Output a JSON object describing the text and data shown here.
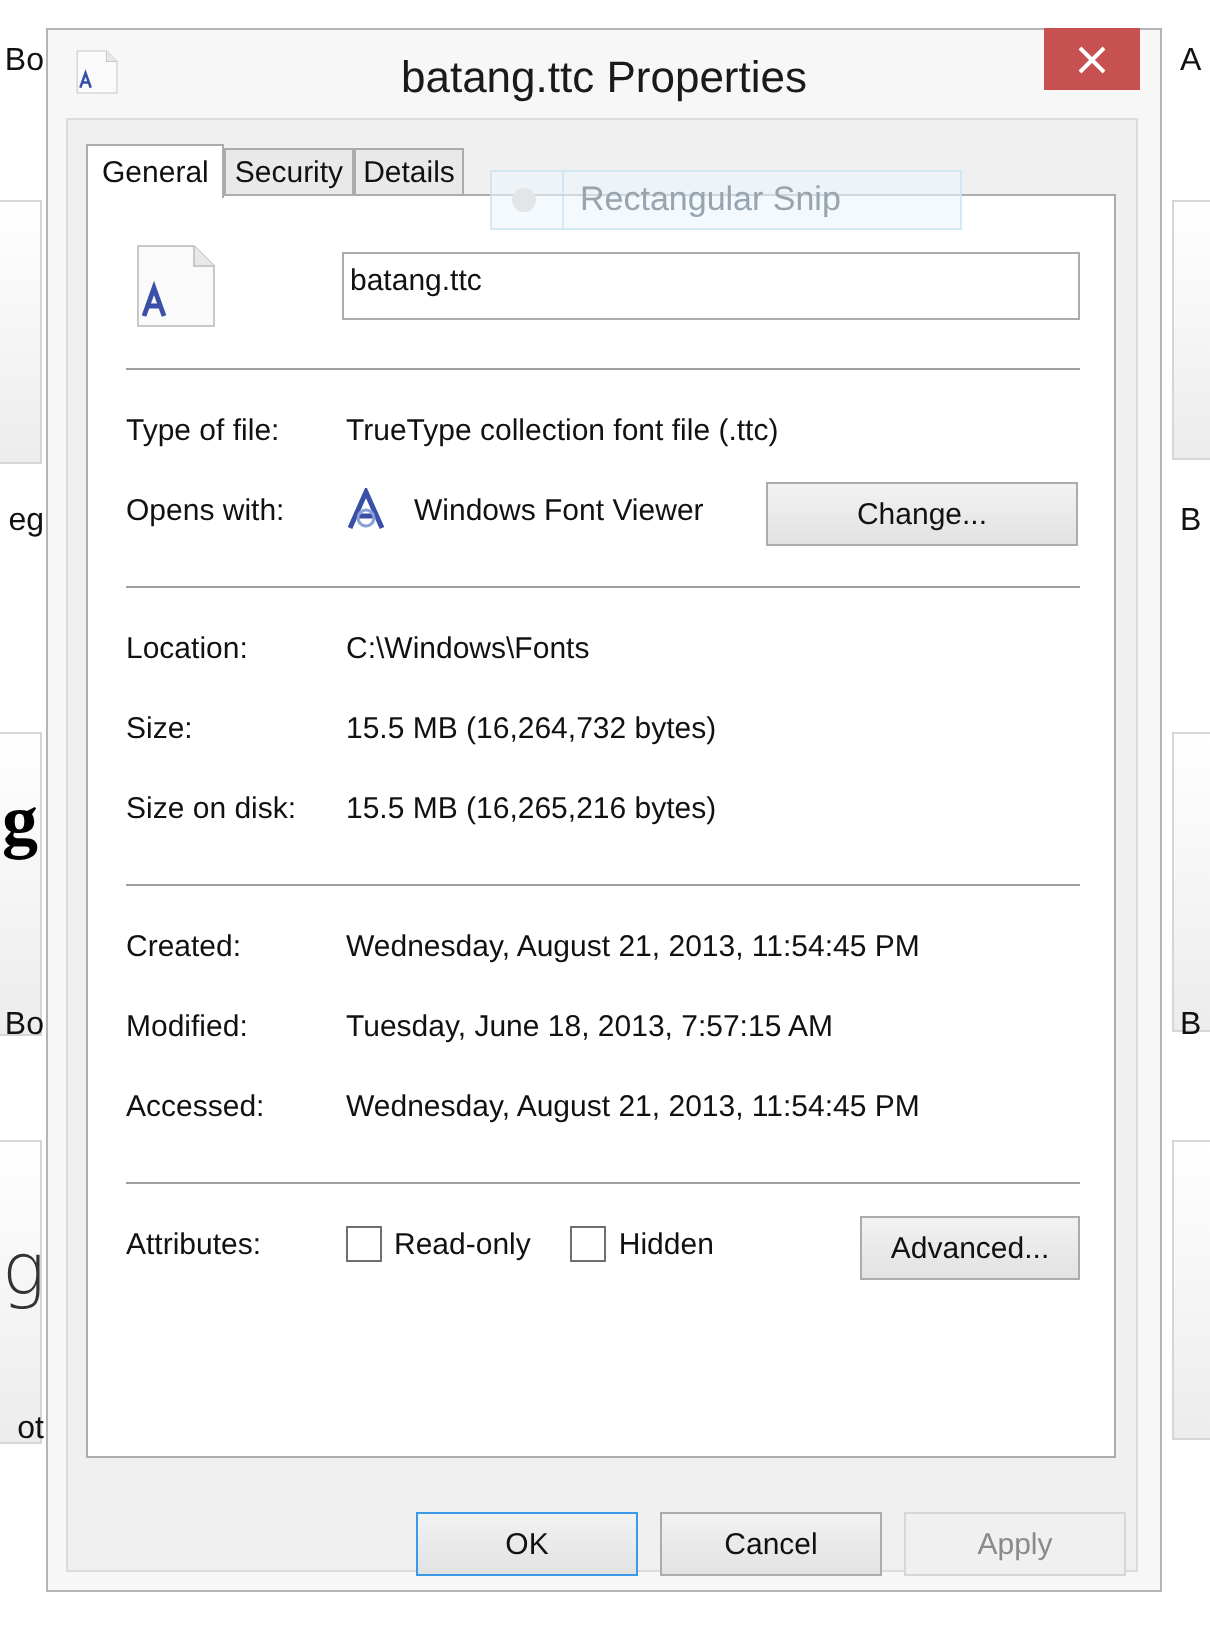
{
  "background": {
    "labels": [
      {
        "text": "Bo"
      },
      {
        "text": "A"
      },
      {
        "text": "eg"
      },
      {
        "text": "B"
      },
      {
        "text": "Bo"
      },
      {
        "text": "B"
      },
      {
        "text": "ot"
      }
    ],
    "previews": [
      {
        "text": "g",
        "kind": "bold"
      },
      {
        "text": "g",
        "kind": "light"
      }
    ]
  },
  "tooltip": {
    "label": "Rectangular Snip"
  },
  "window": {
    "title": "batang.ttc Properties"
  },
  "tabs": [
    {
      "label": "General",
      "selected": true
    },
    {
      "label": "Security",
      "selected": false
    },
    {
      "label": "Details",
      "selected": false
    }
  ],
  "file_name": {
    "value": "batang.ttc"
  },
  "sections": [
    [
      {
        "label": "Type of file:",
        "value": "TrueType collection font file (.ttc)"
      },
      {
        "label": "Opens with:",
        "value": "Windows Font Viewer",
        "kind": "app",
        "button": "Change..."
      }
    ],
    [
      {
        "label": "Location:",
        "value": "C:\\Windows\\Fonts"
      },
      {
        "label": "Size:",
        "value": "15.5 MB (16,264,732 bytes)"
      },
      {
        "label": "Size on disk:",
        "value": "15.5 MB (16,265,216 bytes)"
      }
    ],
    [
      {
        "label": "Created:",
        "value": "Wednesday, August 21, 2013, 11:54:45 PM"
      },
      {
        "label": "Modified:",
        "value": "Tuesday, June 18, 2013, 7:57:15 AM"
      },
      {
        "label": "Accessed:",
        "value": "Wednesday, August 21, 2013, 11:54:45 PM"
      }
    ]
  ],
  "attributes": {
    "label": "Attributes:",
    "checkboxes": [
      {
        "label": "Read-only",
        "checked": false
      },
      {
        "label": "Hidden",
        "checked": false
      }
    ],
    "button": "Advanced..."
  },
  "buttons": [
    {
      "label": "OK",
      "default": true,
      "disabled": false
    },
    {
      "label": "Cancel",
      "default": false,
      "disabled": false
    },
    {
      "label": "Apply",
      "default": false,
      "disabled": true
    }
  ]
}
